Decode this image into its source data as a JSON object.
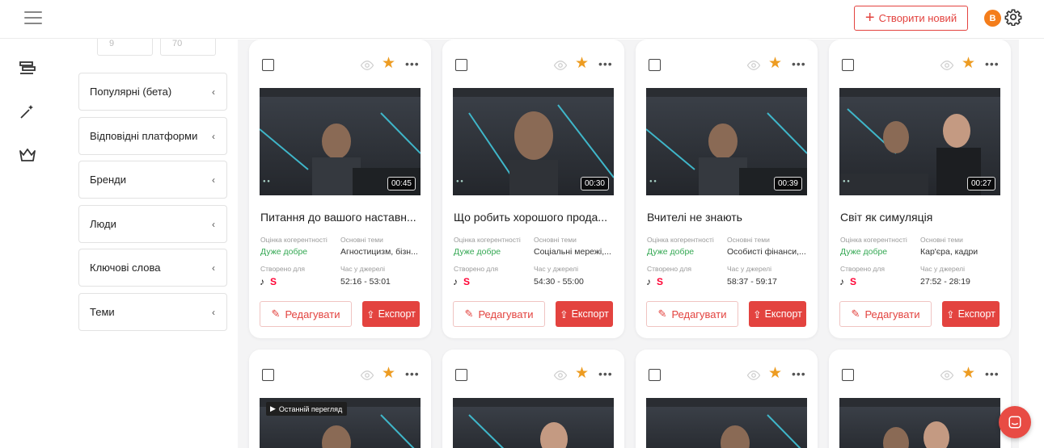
{
  "header": {
    "create_label": "Створити новий",
    "avatar_letter": "В"
  },
  "sidebar": {
    "range": {
      "min": "9",
      "max": "70"
    },
    "filters": [
      {
        "label": "Популярні (бета)"
      },
      {
        "label": "Відповідні платформи"
      },
      {
        "label": "Бренди"
      },
      {
        "label": "Люди"
      },
      {
        "label": "Ключові слова"
      },
      {
        "label": "Теми"
      }
    ]
  },
  "labels": {
    "coherence": "Оцінка когерентності",
    "topics": "Основні теми",
    "created_for": "Створено для",
    "source_time": "Час у джерелі",
    "edit": "Редагувати",
    "export": "Експорт",
    "last_viewed": "Останній перегляд"
  },
  "cards": [
    {
      "duration": "00:45",
      "title": "Питання до вашого наставн...",
      "coherence": "Дуже добре",
      "topics": "Агностицизм, бізн...",
      "source_time": "52:16 - 53:01"
    },
    {
      "duration": "00:30",
      "title": "Що робить хорошого прода...",
      "coherence": "Дуже добре",
      "topics": "Соціальні мережі,...",
      "source_time": "54:30 - 55:00"
    },
    {
      "duration": "00:39",
      "title": "Вчителі не знають",
      "coherence": "Дуже добре",
      "topics": "Особисті фінанси,...",
      "source_time": "58:37 - 59:17"
    },
    {
      "duration": "00:27",
      "title": "Світ як симуляція",
      "coherence": "Дуже добре",
      "topics": "Кар'єра, кадри",
      "source_time": "27:52 - 28:19"
    }
  ],
  "colors": {
    "accent": "#e3433f",
    "star": "#ed9c22",
    "good": "#34a853",
    "avatar": "#f47d1b"
  }
}
